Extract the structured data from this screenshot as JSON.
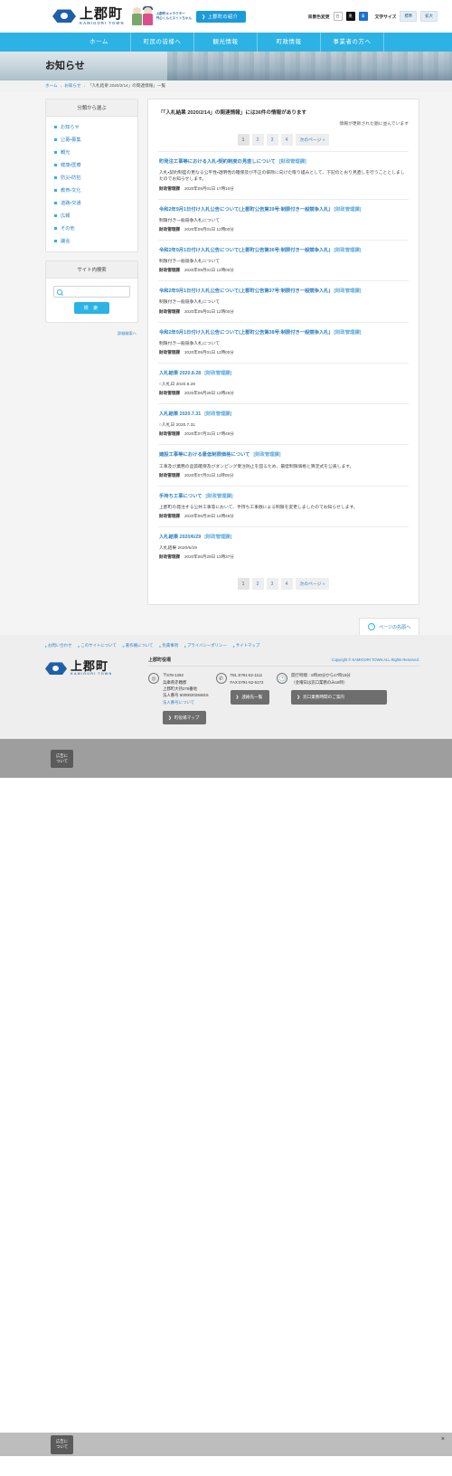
{
  "header": {
    "logo_jp": "上郡町",
    "logo_en": "KAMIGORI TOWN",
    "mascot_label_line1": "上郡町キャラクター",
    "mascot_label_line2": "円心くんとエイトちゃん",
    "intro_button": "上郡町の紹介",
    "bg_color_label": "背景色変更",
    "bg_white": "白",
    "bg_black": "黒",
    "bg_blue": "青",
    "font_size_label": "文字サイズ",
    "font_normal": "標準",
    "font_large": "拡大"
  },
  "nav": {
    "items": [
      {
        "label": "ホーム"
      },
      {
        "label": "町民の皆様へ"
      },
      {
        "label": "観光情報"
      },
      {
        "label": "町政情報"
      },
      {
        "label": "事業者の方へ"
      }
    ]
  },
  "page": {
    "title": "お知らせ",
    "breadcrumb": [
      {
        "label": "ホーム"
      },
      {
        "label": "お知らせ"
      },
      {
        "label": "「入札結果 2020/2/14」の関連情報」一覧"
      }
    ]
  },
  "sidebar": {
    "category_head": "分類から選ぶ",
    "categories": [
      {
        "label": "お知らせ"
      },
      {
        "label": "公募・募集"
      },
      {
        "label": "観光"
      },
      {
        "label": "健康・医療"
      },
      {
        "label": "防災・防犯"
      },
      {
        "label": "教育・文化"
      },
      {
        "label": "道路・交通"
      },
      {
        "label": "広報"
      },
      {
        "label": "その他"
      },
      {
        "label": "議会"
      }
    ],
    "search_head": "サイト内検索",
    "search_placeholder": "",
    "search_value": "",
    "search_button": "検 索",
    "search_note": "詳細検索へ"
  },
  "main": {
    "result_heading": "「「入札結果 2020/2/14」の関連情報」には36件の情報があります",
    "result_sub": "情報が更新された順に並んでいます",
    "pager": {
      "pages": [
        {
          "label": "1",
          "current": true
        },
        {
          "label": "2",
          "current": false
        },
        {
          "label": "3",
          "current": false
        },
        {
          "label": "4",
          "current": false
        }
      ],
      "next_label": "次のページ »"
    },
    "items": [
      {
        "title": "町発注工事等における入札・契約制度の見直しについて",
        "dept_tag": "[財政管理課]",
        "body": "入札・契約制度の更なる公平性・透明性の確保及び不正の排除に向けた取り組みとして、下記のとおり見直しを行うこととしましたのでお知らせします。",
        "meta_dept": "財政管理課",
        "meta_date": "2020年09月01日 17時10分"
      },
      {
        "title": "令和2年9月1日付け入札公告について(上郡町公告第39号:制限付き一般競争入札)",
        "dept_tag": "[財政管理課]",
        "body": "制限付き一般競争入札について",
        "meta_dept": "財政管理課",
        "meta_date": "2020年09月01日 12時00分"
      },
      {
        "title": "令和2年9月1日付け入札公告について(上郡町公告第36号:制限付き一般競争入札)",
        "dept_tag": "[財政管理課]",
        "body": "制限付き一般競争入札について",
        "meta_dept": "財政管理課",
        "meta_date": "2020年09月01日 12時00分"
      },
      {
        "title": "令和2年9月1日付け入札公告について(上郡町公告第37号:制限付き一般競争入札)",
        "dept_tag": "[財政管理課]",
        "body": "制限付き一般競争入札について",
        "meta_dept": "財政管理課",
        "meta_date": "2020年09月01日 12時00分"
      },
      {
        "title": "令和2年9月1日付け入札公告について(上郡町公告第38号:制限付き一般競争入札)",
        "dept_tag": "[財政管理課]",
        "body": "制限付き一般競争入札について",
        "meta_dept": "財政管理課",
        "meta_date": "2020年09月01日 12時00分"
      },
      {
        "title": "入札結果  2020.8.28",
        "dept_tag": "[財政管理課]",
        "body": "○入札日  2020.8.28",
        "meta_dept": "財政管理課",
        "meta_date": "2020年08月28日 13時25分"
      },
      {
        "title": "入札結果  2020.7.31",
        "dept_tag": "[財政管理課]",
        "body": "○入札日  2020.7.31",
        "meta_dept": "財政管理課",
        "meta_date": "2020年07月31日 17時49分"
      },
      {
        "title": "建設工事等における最低制限価格について",
        "dept_tag": "[財政管理課]",
        "body": "工事及び業務の品質確保及びダンピング受注防止を図るため、最低制限価格と算定式を公表します。",
        "meta_dept": "財政管理課",
        "meta_date": "2020年07月01日 11時05分"
      },
      {
        "title": "手持ち工事について",
        "dept_tag": "[財政管理課]",
        "body": "上郡町の発注する公共工事等において、手持ち工事数による制限を変更しましたのでお知らせします。",
        "meta_dept": "財政管理課",
        "meta_date": "2020年06月30日 14時46分"
      },
      {
        "title": "入札結果  2020/6/29",
        "dept_tag": "[財政管理課]",
        "body": "入札結果  2020/6/29",
        "meta_dept": "財政管理課",
        "meta_date": "2020年06月29日 13時37分"
      }
    ],
    "to_top": "ページの先頭へ"
  },
  "footer": {
    "links": [
      {
        "label": "お問い合わせ"
      },
      {
        "label": "このサイトについて"
      },
      {
        "label": "著作権について"
      },
      {
        "label": "免責事項"
      },
      {
        "label": "プライバシーポリシー"
      },
      {
        "label": "サイトマップ"
      }
    ],
    "logo_jp": "上郡町",
    "logo_en": "KAMIGORI TOWN",
    "office_name": "上郡町役場",
    "copyright": "Copyright © KAMIGORI TOWN ALL Rights Reserved.",
    "address_postal": "〒678-1292",
    "address_line1": "兵庫県赤穂郡",
    "address_line2": "上郡町大持278番地",
    "corporate_number": "法人番号 6000020284815",
    "corporate_link": "法人番号について",
    "tel": "TEL:0791-52-1111",
    "fax": "FAX:0791-52-5172",
    "hours_line1": "開庁時間：8時30分から17時15分",
    "hours_line2": "（金曜日は窓口業務のみ18時）",
    "contact_button": "連絡先一覧",
    "counter_button": "窓口業務時間のご案内",
    "map_button": "町役場マップ"
  },
  "ad": {
    "label_line1": "広告に",
    "label_line2": "ついて"
  }
}
